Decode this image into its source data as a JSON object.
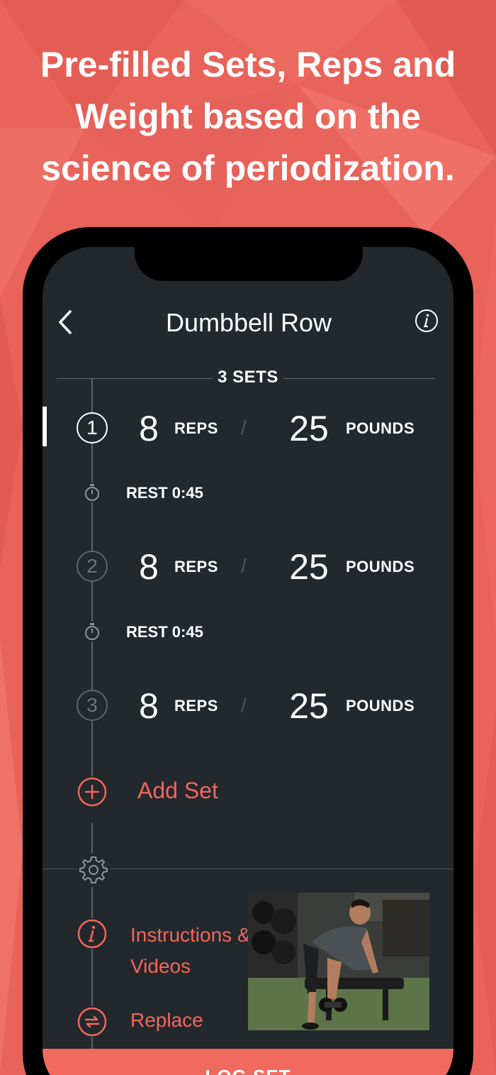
{
  "headline": "Pre-filled Sets, Reps and Weight based on the science of periodization.",
  "colors": {
    "background": "#e8635a",
    "screen": "#23282d",
    "accent": "#f2665c",
    "line": "#5d646a"
  },
  "header": {
    "back_icon": "chevron-left-icon",
    "title": "Dumbbell Row",
    "info_icon": "info-icon"
  },
  "sets_header": {
    "label": "3 SETS"
  },
  "sets": [
    {
      "number": "1",
      "reps": "8",
      "reps_label": "REPS",
      "separator": "/",
      "weight": "25",
      "weight_label": "POUNDS",
      "active": true
    },
    {
      "number": "2",
      "reps": "8",
      "reps_label": "REPS",
      "separator": "/",
      "weight": "25",
      "weight_label": "POUNDS",
      "active": false
    },
    {
      "number": "3",
      "reps": "8",
      "reps_label": "REPS",
      "separator": "/",
      "weight": "25",
      "weight_label": "POUNDS",
      "active": false
    }
  ],
  "rests": [
    {
      "label": "REST 0:45",
      "icon": "stopwatch-icon"
    },
    {
      "label": "REST 0:45",
      "icon": "stopwatch-icon"
    }
  ],
  "add_set": {
    "label": "Add Set",
    "icon": "plus-circle-icon"
  },
  "options": {
    "settings_icon": "gear-icon",
    "instructions_label": "Instructions & Videos",
    "instructions_icon": "info-circle-icon",
    "replace_label": "Replace",
    "replace_icon": "swap-arrows-icon"
  },
  "footer": {
    "log_set_label": "LOG SET"
  }
}
